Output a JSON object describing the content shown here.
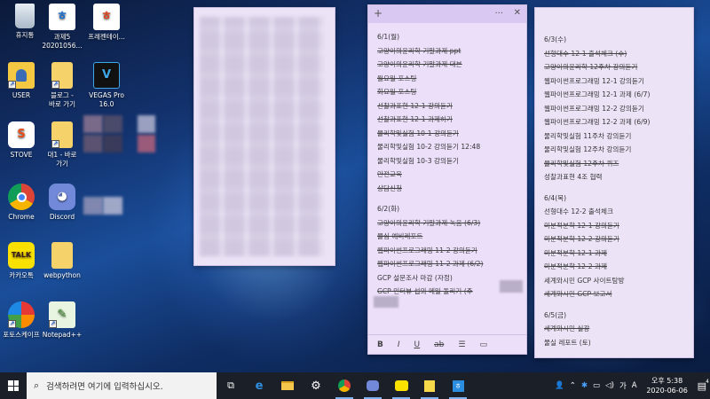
{
  "desktop": {
    "icons": [
      {
        "label": "휴지통"
      },
      {
        "label": "과제5\n20201056..."
      },
      {
        "label": "프레젠테이..."
      },
      {
        "label": "USER"
      },
      {
        "label": "블로그 -\n바로 가기"
      },
      {
        "label": "VEGAS Pro\n16.0"
      },
      {
        "label": "STOVE"
      },
      {
        "label": "대1 - 바로\n가기"
      },
      {
        "label": "Chrome"
      },
      {
        "label": "Discord"
      },
      {
        "label": "카카오톡"
      },
      {
        "label": "webpython"
      },
      {
        "label": "포토스케이프"
      },
      {
        "label": "Notepad++"
      }
    ]
  },
  "note_middle": {
    "add_glyph": "+",
    "menu_glyph": "···",
    "close_glyph": "✕",
    "lines": [
      {
        "text": "6/1(월)",
        "done": false
      },
      {
        "text": "고양이의윤리학 기말과제 ppt",
        "done": true
      },
      {
        "text": "고양이의윤리학 기말과제 대본",
        "done": true
      },
      {
        "text": "월요일 포스팅",
        "done": true
      },
      {
        "text": "화요일 포스팅",
        "done": true
      },
      {
        "text": "선찰과표현 12-1 강의듣기",
        "done": true
      },
      {
        "text": "선찰과표현 12-1 과제하기",
        "done": true
      },
      {
        "text": "물리학및실험 10-1 강의듣기",
        "done": true
      },
      {
        "text": "물리학및실험 10-2 강의듣기 12:48",
        "done": false
      },
      {
        "text": "물리학및실험 10-3 강의듣기",
        "done": false
      },
      {
        "text": "안전교육",
        "done": true
      },
      {
        "text": "상담신청",
        "done": true
      },
      {
        "text": "",
        "done": false
      },
      {
        "text": "6/2(화)",
        "done": false
      },
      {
        "text": "고양이의윤리학 기말과제 녹음 (6/3)",
        "done": true
      },
      {
        "text": "물심 예비레포트",
        "done": true
      },
      {
        "text": "웹파이썬프로그래밍 11-2 강의듣기",
        "done": true
      },
      {
        "text": "웹파이썬프로그래밍 11-2 과제 (6/2)",
        "done": true
      },
      {
        "text": "GCP 설문조사 마감 (자정)",
        "done": false
      },
      {
        "text": "GCP 인터뷰 섭외 메일 돌리기 (주",
        "done": true
      }
    ],
    "toolbar": {
      "bold": "B",
      "italic": "I",
      "underline": "U",
      "strike": "ab",
      "list": "☰",
      "image": "▭"
    }
  },
  "note_right": {
    "lines": [
      {
        "text": "6/3(수)",
        "done": false
      },
      {
        "text": "선형대수 12-1 출석체크 (수)",
        "done": true
      },
      {
        "text": "고양이의윤리학 12주차 강의듣기",
        "done": true
      },
      {
        "text": "웹파이썬프로그래밍 12-1 강의듣기",
        "done": false
      },
      {
        "text": "웹파이썬프로그래밍 12-1 과제 (6/7)",
        "done": false
      },
      {
        "text": "웹파이썬프로그래밍 12-2 강의듣기",
        "done": false
      },
      {
        "text": "웹파이썬프로그래밍 12-2 과제 (6/9)",
        "done": false
      },
      {
        "text": "물리학및실험 11주차 강의듣기",
        "done": false
      },
      {
        "text": "물리학및실험 12주차 강의듣기",
        "done": false
      },
      {
        "text": "물리학및실험 12주차 퀴즈",
        "done": true
      },
      {
        "text": "성찰과표현 4조 협력",
        "done": false
      },
      {
        "text": "",
        "done": false
      },
      {
        "text": "6/4(목)",
        "done": false
      },
      {
        "text": "선형대수 12-2 출석체크",
        "done": false
      },
      {
        "text": "미분적분학 12-1 강의듣기",
        "done": true
      },
      {
        "text": "미분적분학 12-2 강의듣기",
        "done": true
      },
      {
        "text": "미분적분학 12-1 과제",
        "done": true
      },
      {
        "text": "미분적분학 12-2 과제",
        "done": true
      },
      {
        "text": "세계와시민 GCP 사이트탐방",
        "done": false
      },
      {
        "text": "세계와시민 GCP 보고서",
        "done": true
      },
      {
        "text": "",
        "done": false
      },
      {
        "text": "6/5(금)",
        "done": false
      },
      {
        "text": "세계와시민 실강",
        "done": true
      },
      {
        "text": "물실 레포트 (토)",
        "done": false
      }
    ]
  },
  "taskbar": {
    "search_placeholder": "검색하려면 여기에 입력하십시오.",
    "ime": "가",
    "time": "오후 5:38",
    "date": "2020-06-06",
    "notification_count": "4"
  }
}
